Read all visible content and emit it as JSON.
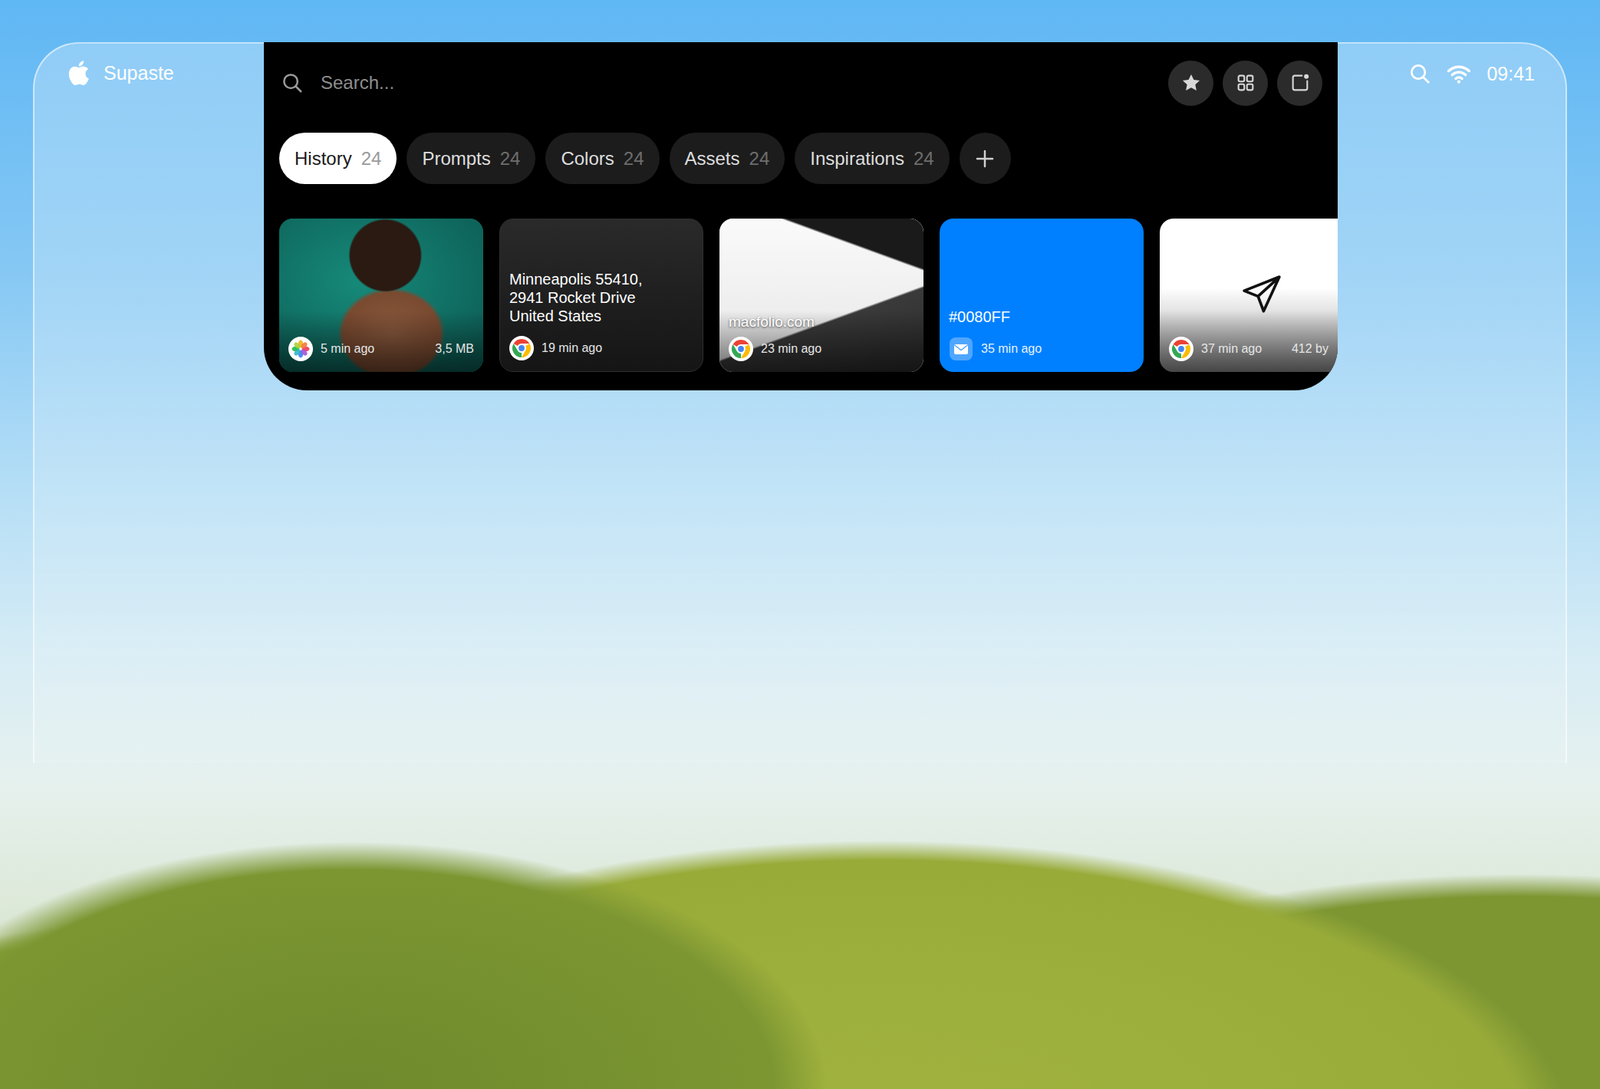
{
  "app": {
    "name": "Supaste"
  },
  "status_bar": {
    "time": "09:41"
  },
  "search": {
    "placeholder": "Search..."
  },
  "tabs": [
    {
      "label": "History",
      "count": "24",
      "selected": true
    },
    {
      "label": "Prompts",
      "count": "24",
      "selected": false
    },
    {
      "label": "Colors",
      "count": "24",
      "selected": false
    },
    {
      "label": "Assets",
      "count": "24",
      "selected": false
    },
    {
      "label": "Inspirations",
      "count": "24",
      "selected": false
    }
  ],
  "cards": [
    {
      "kind": "image",
      "time": "5 min ago",
      "size": "3,5 MB"
    },
    {
      "kind": "text",
      "lines": [
        "Minneapolis 55410,",
        "2941 Rocket Drive",
        "United States"
      ],
      "time": "19 min ago"
    },
    {
      "kind": "link",
      "url": "macfolio.com",
      "time": "23 min ago"
    },
    {
      "kind": "color",
      "value": "#0080FF",
      "time": "35 min ago"
    },
    {
      "kind": "file",
      "time": "37 min ago",
      "size": "412 by"
    }
  ]
}
